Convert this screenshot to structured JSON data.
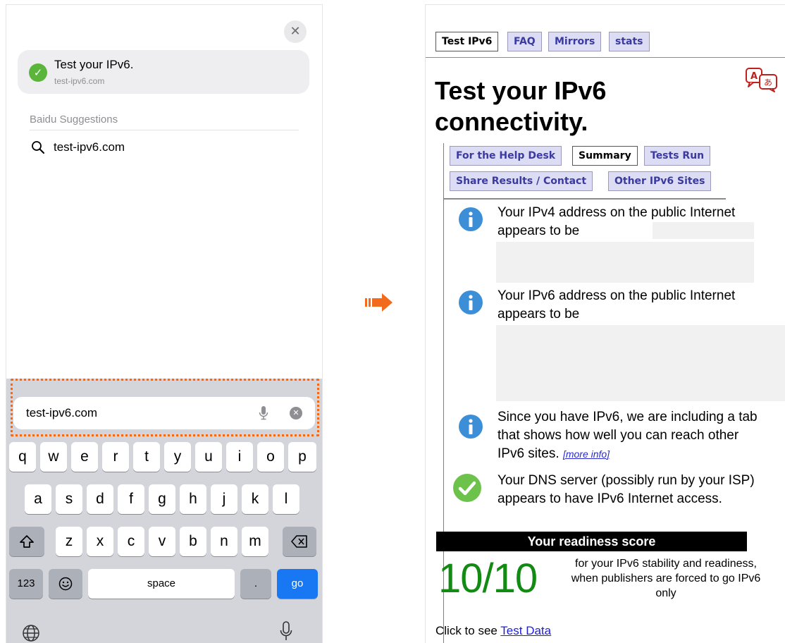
{
  "left_phone": {
    "top_hit": {
      "title": "Test your IPv6.",
      "url": "test-ipv6.com"
    },
    "suggestions": {
      "header": "Baidu Suggestions",
      "items": [
        {
          "label": "test-ipv6.com"
        }
      ]
    },
    "url_field": {
      "value": "test-ipv6.com"
    },
    "keyboard": {
      "row1": [
        "q",
        "w",
        "e",
        "r",
        "t",
        "y",
        "u",
        "i",
        "o",
        "p"
      ],
      "row2": [
        "a",
        "s",
        "d",
        "f",
        "g",
        "h",
        "j",
        "k",
        "l"
      ],
      "row3": [
        "z",
        "x",
        "c",
        "v",
        "b",
        "n",
        "m"
      ],
      "numbers_key": "123",
      "space_key": "space",
      "period_key": ".",
      "go_key": "go"
    }
  },
  "colors": {
    "highlight_border": "#f06a1a",
    "arrow": "#f26a1b",
    "go_key": "#1878f3",
    "score_green": "#138a13"
  },
  "icons": {
    "close": "close-icon",
    "check": "check-circle-icon",
    "search": "search-icon",
    "mic": "mic-icon",
    "clear": "clear-icon",
    "shift": "shift-icon",
    "delete": "backspace-icon",
    "emoji": "emoji-icon",
    "globe": "globe-icon",
    "arrow": "arrow-right-icon",
    "translate": "translate-icon",
    "info": "info-icon"
  },
  "right_phone": {
    "top_tabs": [
      "Test IPv6",
      "FAQ",
      "Mirrors",
      "stats"
    ],
    "page_title": "Test your IPv6 connectivity.",
    "sub_tabs_row1": [
      "For the Help Desk",
      "Summary",
      "Tests Run"
    ],
    "sub_tabs_row2": [
      "Share Results / Contact",
      "Other IPv6 Sites"
    ],
    "messages": {
      "ipv4": "Your IPv4 address on the public Internet appears to be",
      "ipv6": "Your IPv6 address on the public Internet appears to be",
      "tab_info": "Since you have IPv6, we are including a tab that shows how well you can reach other IPv6 sites.",
      "more_info": "[more info]",
      "dns": "Your DNS server (possibly run by your ISP) appears to have IPv6 Internet access."
    },
    "readiness": {
      "header": "Your readiness score",
      "score": "10/10",
      "description": "for your IPv6 stability and readiness, when publishers are forced to go IPv6 only"
    },
    "footer": {
      "prefix": "Click to see",
      "link": "Test Data"
    }
  }
}
